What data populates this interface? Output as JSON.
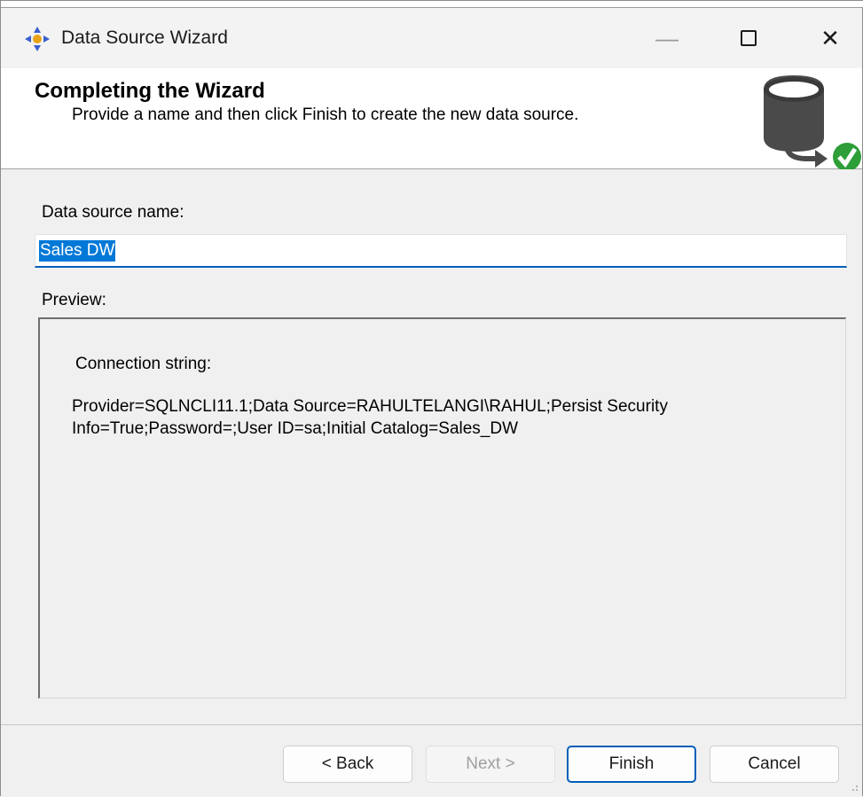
{
  "window": {
    "title": "Data Source Wizard",
    "minimize_glyph": "—",
    "close_glyph": "✕"
  },
  "header": {
    "title": "Completing the Wizard",
    "subtitle": "Provide a name and then click Finish to create the new data source.",
    "icon": "database-check-icon"
  },
  "form": {
    "name_label": "Data source name:",
    "name_value": "Sales DW",
    "preview_label": "Preview:",
    "connection_label": "Connection string:",
    "connection_string": "Provider=SQLNCLI11.1;Data Source=RAHULTELANGI\\RAHUL;Persist Security Info=True;Password=;User ID=sa;Initial Catalog=Sales_DW"
  },
  "buttons": {
    "back": "< Back",
    "next": "Next >",
    "finish": "Finish",
    "cancel": "Cancel"
  },
  "colors": {
    "accent": "#005fb8",
    "selection": "#0078d7",
    "check_green": "#2e9e38"
  }
}
